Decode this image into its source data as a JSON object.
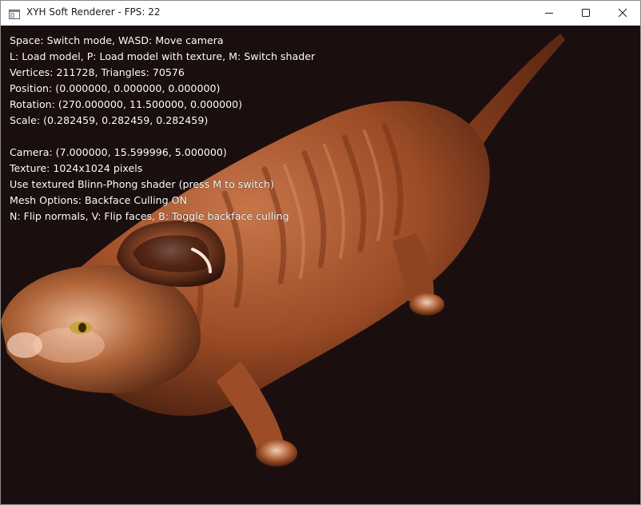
{
  "window": {
    "title": "XYH Soft Renderer - FPS: 22"
  },
  "overlay": {
    "lines": [
      "Space: Switch mode, WASD: Move camera",
      "L: Load model, P: Load model with texture, M: Switch shader",
      "Vertices: 211728, Triangles: 70576",
      "Position: (0.000000, 0.000000, 0.000000)",
      "Rotation: (270.000000, 11.500000, 0.000000)",
      "Scale: (0.282459, 0.282459, 0.282459)",
      "",
      "Camera: (7.000000, 15.599996, 5.000000)",
      "Texture: 1024x1024 pixels",
      "Use textured Blinn-Phong shader (press M to switch)",
      "Mesh Options: Backface Culling ON",
      "N: Flip normals, V: Flip faces, B: Toggle backface culling"
    ]
  },
  "icons": {
    "app": "app-window-icon",
    "minimize": "minimize-icon",
    "maximize": "maximize-icon",
    "close": "close-icon"
  },
  "colors": {
    "background": "#1b0e0e",
    "fur_base": "#b8643a",
    "fur_dark": "#6e3418",
    "highlight": "#f6d6c2",
    "eye": "#c9a43a"
  }
}
